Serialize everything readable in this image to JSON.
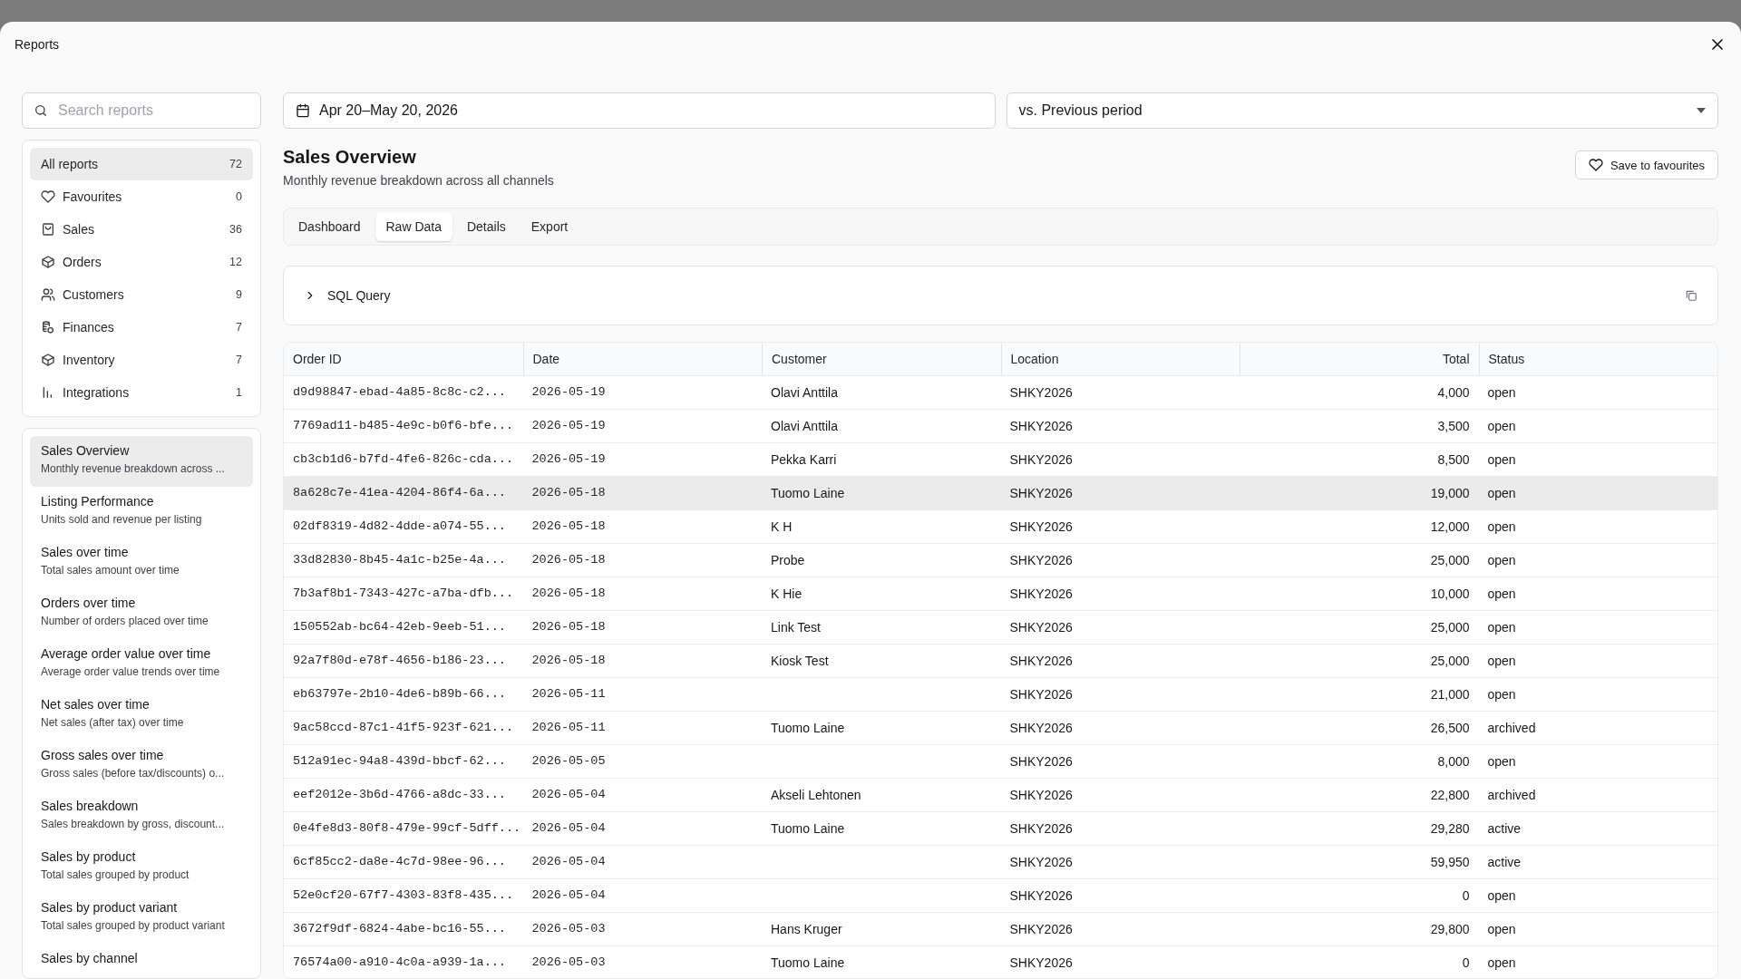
{
  "window": {
    "title": "Reports"
  },
  "search": {
    "placeholder": "Search reports"
  },
  "categories": [
    {
      "label": "All reports",
      "count": "72",
      "selected": true
    },
    {
      "label": "Favourites",
      "count": "0",
      "selected": false
    },
    {
      "label": "Sales",
      "count": "36",
      "selected": false
    },
    {
      "label": "Orders",
      "count": "12",
      "selected": false
    },
    {
      "label": "Customers",
      "count": "9",
      "selected": false
    },
    {
      "label": "Finances",
      "count": "7",
      "selected": false
    },
    {
      "label": "Inventory",
      "count": "7",
      "selected": false
    },
    {
      "label": "Integrations",
      "count": "1",
      "selected": false
    }
  ],
  "reports": [
    {
      "title": "Sales Overview",
      "description": "Monthly revenue breakdown across ...",
      "selected": true
    },
    {
      "title": "Listing Performance",
      "description": "Units sold and revenue per listing",
      "selected": false
    },
    {
      "title": "Sales over time",
      "description": "Total sales amount over time",
      "selected": false
    },
    {
      "title": "Orders over time",
      "description": "Number of orders placed over time",
      "selected": false
    },
    {
      "title": "Average order value over time",
      "description": "Average order value trends over time",
      "selected": false
    },
    {
      "title": "Net sales over time",
      "description": "Net sales (after tax) over time",
      "selected": false
    },
    {
      "title": "Gross sales over time",
      "description": "Gross sales (before tax/discounts) o...",
      "selected": false
    },
    {
      "title": "Sales breakdown",
      "description": "Sales breakdown by gross, discount...",
      "selected": false
    },
    {
      "title": "Sales by product",
      "description": "Total sales grouped by product",
      "selected": false
    },
    {
      "title": "Sales by product variant",
      "description": "Total sales grouped by product variant",
      "selected": false
    },
    {
      "title": "Sales by channel",
      "selected": false
    }
  ],
  "date_range": {
    "value": "Apr 20–May 20, 2026"
  },
  "comparison": {
    "value": "vs. Previous period"
  },
  "report": {
    "title": "Sales Overview",
    "subtitle": "Monthly revenue breakdown across all channels",
    "favourite_button": "Save to favourites"
  },
  "tabs": [
    {
      "label": "Dashboard",
      "selected": false
    },
    {
      "label": "Raw Data",
      "selected": true
    },
    {
      "label": "Details",
      "selected": false
    },
    {
      "label": "Export",
      "selected": false
    }
  ],
  "sql_panel": {
    "label": "SQL Query",
    "expanded": false
  },
  "table": {
    "columns": [
      "Order ID",
      "Date",
      "Customer",
      "Location",
      "Total",
      "Status"
    ],
    "rows": [
      {
        "cells": [
          "d9d98847-ebad-4a85-8c8c-c2...",
          "2026-05-19",
          "Olavi Anttila",
          "SHKY2026",
          "4,000",
          "open"
        ],
        "highlighted": false
      },
      {
        "cells": [
          "7769ad11-b485-4e9c-b0f6-bfe...",
          "2026-05-19",
          "Olavi Anttila",
          "SHKY2026",
          "3,500",
          "open"
        ],
        "highlighted": false
      },
      {
        "cells": [
          "cb3cb1d6-b7fd-4fe6-826c-cda...",
          "2026-05-19",
          "Pekka Karri",
          "SHKY2026",
          "8,500",
          "open"
        ],
        "highlighted": false
      },
      {
        "cells": [
          "8a628c7e-41ea-4204-86f4-6a...",
          "2026-05-18",
          "Tuomo Laine",
          "SHKY2026",
          "19,000",
          "open"
        ],
        "highlighted": true
      },
      {
        "cells": [
          "02df8319-4d82-4dde-a074-55...",
          "2026-05-18",
          "K H",
          "SHKY2026",
          "12,000",
          "open"
        ],
        "highlighted": false
      },
      {
        "cells": [
          "33d82830-8b45-4a1c-b25e-4a...",
          "2026-05-18",
          "Probe",
          "SHKY2026",
          "25,000",
          "open"
        ],
        "highlighted": false
      },
      {
        "cells": [
          "7b3af8b1-7343-427c-a7ba-dfb...",
          "2026-05-18",
          "K Hie",
          "SHKY2026",
          "10,000",
          "open"
        ],
        "highlighted": false
      },
      {
        "cells": [
          "150552ab-bc64-42eb-9eeb-51...",
          "2026-05-18",
          "Link Test",
          "SHKY2026",
          "25,000",
          "open"
        ],
        "highlighted": false
      },
      {
        "cells": [
          "92a7f80d-e78f-4656-b186-23...",
          "2026-05-18",
          "Kiosk Test",
          "SHKY2026",
          "25,000",
          "open"
        ],
        "highlighted": false
      },
      {
        "cells": [
          "eb63797e-2b10-4de6-b89b-66...",
          "2026-05-11",
          null,
          "SHKY2026",
          "21,000",
          "open"
        ],
        "highlighted": false
      },
      {
        "cells": [
          "9ac58ccd-87c1-41f5-923f-621...",
          "2026-05-11",
          "Tuomo Laine",
          "SHKY2026",
          "26,500",
          "archived"
        ],
        "highlighted": false
      },
      {
        "cells": [
          "512a91ec-94a8-439d-bbcf-62...",
          "2026-05-05",
          null,
          "SHKY2026",
          "8,000",
          "open"
        ],
        "highlighted": false
      },
      {
        "cells": [
          "eef2012e-3b6d-4766-a8dc-33...",
          "2026-05-04",
          "Akseli Lehtonen",
          "SHKY2026",
          "22,800",
          "archived"
        ],
        "highlighted": false
      },
      {
        "cells": [
          "0e4fe8d3-80f8-479e-99cf-5dff...",
          "2026-05-04",
          "Tuomo Laine",
          "SHKY2026",
          "29,280",
          "active"
        ],
        "highlighted": false
      },
      {
        "cells": [
          "6cf85cc2-da8e-4c7d-98ee-96...",
          "2026-05-04",
          null,
          "SHKY2026",
          "59,950",
          "active"
        ],
        "highlighted": false
      },
      {
        "cells": [
          "52e0cf20-67f7-4303-83f8-435...",
          "2026-05-04",
          null,
          "SHKY2026",
          "0",
          "open"
        ],
        "highlighted": false
      },
      {
        "cells": [
          "3672f9df-6824-4abe-bc16-55...",
          "2026-05-03",
          "Hans Kruger",
          "SHKY2026",
          "29,800",
          "open"
        ],
        "highlighted": false
      },
      {
        "cells": [
          "76574a00-a910-4c0a-a939-1a...",
          "2026-05-03",
          "Tuomo Laine",
          "SHKY2026",
          "0",
          "open"
        ],
        "highlighted": false
      }
    ]
  }
}
